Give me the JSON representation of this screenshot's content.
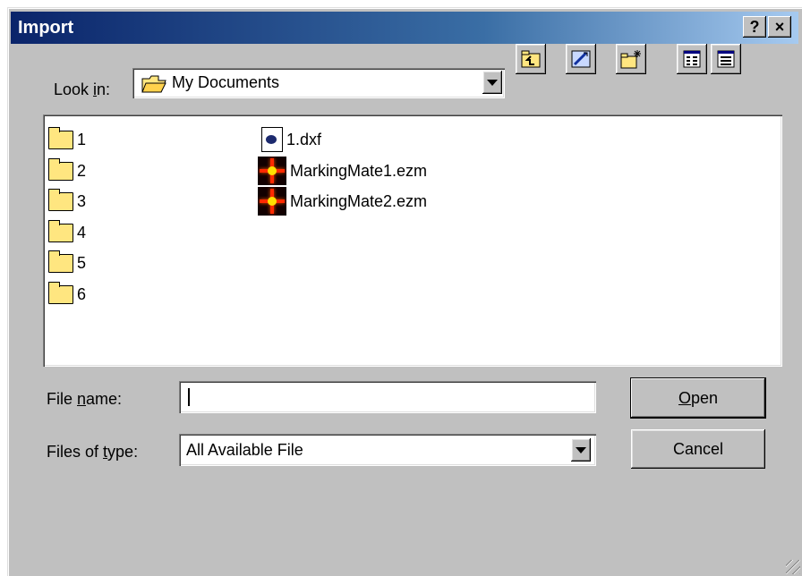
{
  "window": {
    "title": "Import",
    "help_label": "?",
    "close_label": "×"
  },
  "look_in": {
    "label_prefix": "Look ",
    "label_mnemonic": "i",
    "label_suffix": "n:",
    "value": "My Documents"
  },
  "toolbar": {
    "icons": [
      "up-one-level-icon",
      "desktop-icon",
      "new-folder-icon",
      "list-view-icon",
      "details-view-icon"
    ]
  },
  "files": {
    "folders": [
      "1",
      "2",
      "3",
      "4",
      "5",
      "6"
    ],
    "documents": [
      {
        "name": "1.dxf",
        "icon": "dxf-file-icon"
      },
      {
        "name": "MarkingMate1.ezm",
        "icon": "ezm-file-icon"
      },
      {
        "name": "MarkingMate2.ezm",
        "icon": "ezm-file-icon"
      }
    ]
  },
  "file_name": {
    "label_prefix": "File ",
    "label_mnemonic": "n",
    "label_suffix": "ame:",
    "value": ""
  },
  "file_type": {
    "label_prefix": "Files of ",
    "label_mnemonic": "t",
    "label_suffix": "ype:",
    "value": "All Available File"
  },
  "buttons": {
    "open_mnemonic": "O",
    "open_rest": "pen",
    "cancel": "Cancel"
  }
}
